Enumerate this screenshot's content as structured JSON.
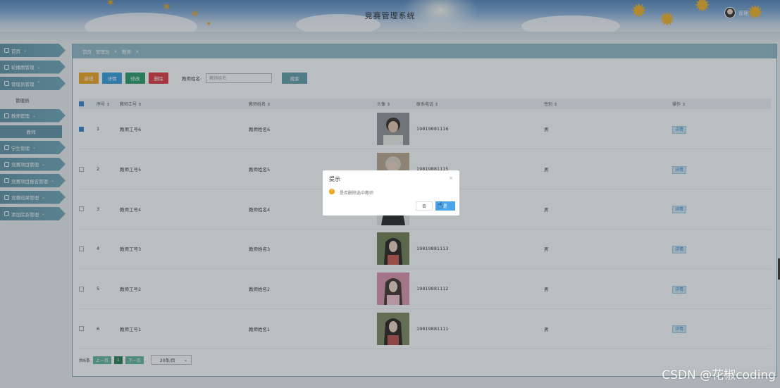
{
  "header": {
    "title": "竞赛管理系统",
    "user": "管理"
  },
  "sidebar": {
    "items": [
      {
        "label": "首页",
        "icon": "home-icon"
      },
      {
        "label": "轮播图管理",
        "icon": "image-icon"
      },
      {
        "label": "管理员管理",
        "icon": "admin-icon"
      },
      {
        "label": "教师管理",
        "icon": "user-icon"
      },
      {
        "label": "学生管理",
        "icon": "user-icon"
      },
      {
        "label": "竞赛项目管理",
        "icon": "gear-icon"
      },
      {
        "label": "竞赛项目报名管理",
        "icon": "grid-icon"
      },
      {
        "label": "竞赛结果管理",
        "icon": "chart-icon"
      },
      {
        "label": "添加院系管理",
        "icon": "list-icon"
      }
    ],
    "sub_admin": "管理员",
    "sub_teacher": "教师"
  },
  "breadcrumb": {
    "home": "首页",
    "admin": "管理员",
    "teacher": "教师"
  },
  "toolbar": {
    "add": "新增",
    "detail": "详情",
    "edit": "修改",
    "delete": "删除",
    "search_label": "教师姓名:",
    "search_placeholder": "教师姓名",
    "search_button": "搜索"
  },
  "table": {
    "headers": [
      "序号",
      "教师工号",
      "教师姓名",
      "头像",
      "联系电话",
      "性别",
      "操作"
    ],
    "rows": [
      {
        "index": "1",
        "id": "教师工号6",
        "name": "教师姓名6",
        "phone": "19819881116",
        "gender": "男",
        "checked": true
      },
      {
        "index": "2",
        "id": "教师工号5",
        "name": "教师姓名5",
        "phone": "19819881115",
        "gender": "男",
        "checked": false
      },
      {
        "index": "3",
        "id": "教师工号4",
        "name": "教师姓名4",
        "phone": "",
        "gender": "男",
        "checked": false
      },
      {
        "index": "4",
        "id": "教师工号3",
        "name": "教师姓名3",
        "phone": "19819881113",
        "gender": "男",
        "checked": false
      },
      {
        "index": "5",
        "id": "教师工号2",
        "name": "教师姓名2",
        "phone": "19819881112",
        "gender": "男",
        "checked": false
      },
      {
        "index": "6",
        "id": "教师工号1",
        "name": "教师姓名1",
        "phone": "19819881111",
        "gender": "男",
        "checked": false
      }
    ],
    "action": "详情"
  },
  "pager": {
    "total": "共6条",
    "prev": "上一页",
    "page": "1",
    "next": "下一页",
    "size": "20条/页"
  },
  "dialog": {
    "title": "提示",
    "message": "是否删除选中教师",
    "cancel": "否",
    "ok": "是"
  },
  "watermark": "CSDN @花椒coding"
}
